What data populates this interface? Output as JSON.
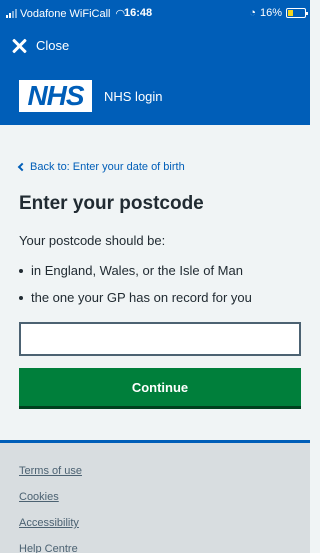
{
  "status_bar": {
    "carrier": "Vodafone WiFiCall",
    "time": "16:48",
    "battery": "16%",
    "wifi_icon": "wifi-icon",
    "battery_level": 0.16
  },
  "header": {
    "close_label": "Close",
    "logo_text": "NHS",
    "brand_title": "NHS login"
  },
  "main": {
    "back_link": "Back to: Enter your date of birth",
    "title": "Enter your postcode",
    "hint": "Your postcode should be:",
    "bullets": [
      "in England, Wales, or the Isle of Man",
      "the one your GP has on record for you"
    ],
    "postcode_value": "",
    "continue_label": "Continue"
  },
  "footer": {
    "links": [
      "Terms of use",
      "Cookies",
      "Accessibility",
      "Help Centre"
    ]
  },
  "colors": {
    "nhs_blue": "#005eb8",
    "button_green": "#007f3b",
    "footer_grey": "#d8dde0"
  }
}
